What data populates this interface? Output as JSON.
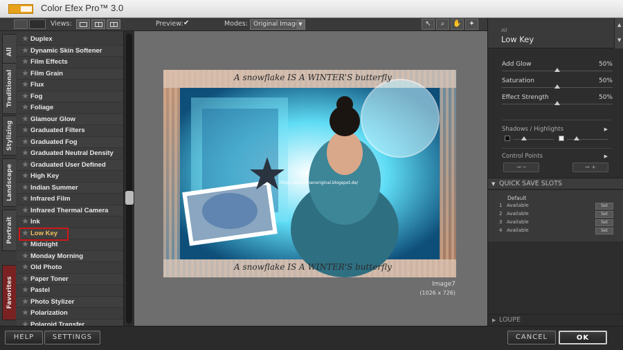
{
  "window": {
    "title": "Color Efex Pro™ 3.0"
  },
  "toolbar": {
    "views_label": "Views:",
    "preview_label": "Preview:",
    "preview_checked": "✔",
    "modes_label": "Modes:",
    "mode_value": "Original Image"
  },
  "tabs": [
    "All",
    "Traditional",
    "Stylizing",
    "Landscape",
    "Portrait",
    "Favorites"
  ],
  "filters": [
    "Duplex",
    "Dynamic Skin Softener",
    "Film Effects",
    "Film Grain",
    "Flux",
    "Fog",
    "Foliage",
    "Glamour Glow",
    "Graduated Filters",
    "Graduated Fog",
    "Graduated Neutral Density",
    "Graduated User Defined",
    "High Key",
    "Indian Summer",
    "Infrared Film",
    "Infrared Thermal Camera",
    "Ink",
    "Low Key",
    "Midnight",
    "Monday Morning",
    "Old Photo",
    "Paper Toner",
    "Pastel",
    "Photo Stylizer",
    "Polarization",
    "Polaroid Transfer"
  ],
  "selected_filter": "Low Key",
  "image": {
    "name": "Image7",
    "size": "(1026 x 726)",
    "banner_text": "A snowflake IS A WINTER'S butterfly",
    "watermark": "https://tamachanoriginal.blogspot.de/"
  },
  "panel": {
    "category": "All",
    "filter_name": "Low Key",
    "sliders": [
      {
        "label": "Add Glow",
        "value": "50%",
        "level": 0.5
      },
      {
        "label": "Saturation",
        "value": "50%",
        "level": 0.5
      },
      {
        "label": "Effect Strength",
        "value": "50%",
        "level": 0.5
      }
    ],
    "shadows_highlights": "Shadows / Highlights",
    "control_points": "Control Points",
    "quick_save": "QUICK SAVE SLOTS",
    "quick_default": "Default",
    "slots": [
      {
        "num": "1",
        "status": "Available",
        "btn": "Set"
      },
      {
        "num": "2",
        "status": "Available",
        "btn": "Set"
      },
      {
        "num": "3",
        "status": "Available",
        "btn": "Set"
      },
      {
        "num": "4",
        "status": "Available",
        "btn": "Set"
      }
    ],
    "loupe": "LOUPE"
  },
  "bottom": {
    "help": "HELP",
    "settings": "SETTINGS",
    "cancel": "CANCEL",
    "ok": "OK"
  },
  "colors": {
    "selection_border": "#d01818",
    "accent_highlight": "#f2c060",
    "image_accent": "#3fd0f0"
  }
}
